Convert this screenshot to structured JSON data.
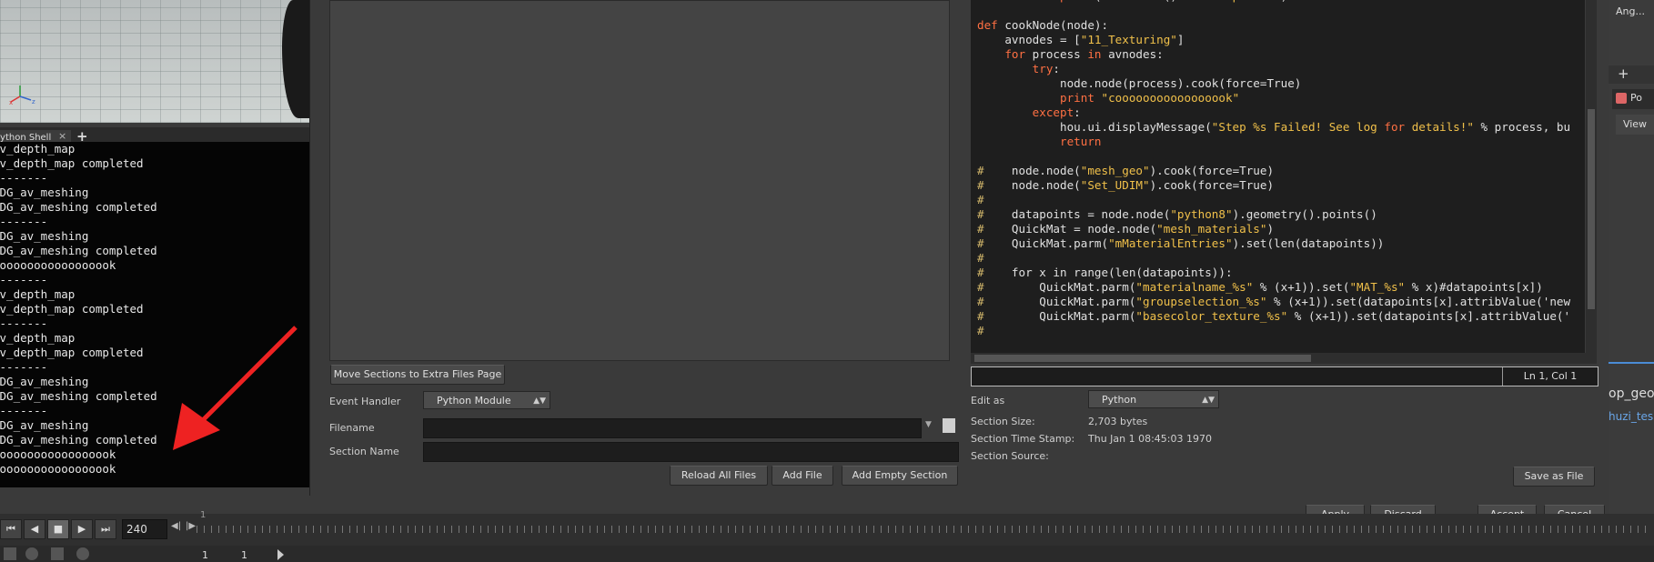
{
  "shell": {
    "tab_label": "Python Shell",
    "lines": [
      "av_depth_map",
      "av_depth_map completed",
      "--------",
      "PDG_av_meshing",
      "PDG_av_meshing completed",
      "--------",
      "PDG_av_meshing",
      "PDG_av_meshing completed",
      "cooooooooooooooook",
      "--------",
      "av_depth_map",
      "av_depth_map completed",
      "--------",
      "av_depth_map",
      "av_depth_map completed",
      "--------",
      "PDG_av_meshing",
      "PDG_av_meshing completed",
      "--------",
      "PDG_av_meshing",
      "PDG_av_meshing completed",
      "cooooooooooooooook",
      "cooooooooooooooook"
    ]
  },
  "timeline": {
    "current_frame": "240",
    "start_frame": "1",
    "range_start": "1",
    "range_end": "1"
  },
  "editor": {
    "move_sections_button": "Move Sections to Extra Files Page",
    "event_handler_label": "Event Handler",
    "event_handler_value": "Python Module",
    "filename_label": "Filename",
    "section_name_label": "Section Name",
    "reload_all_files_button": "Reload All Files",
    "add_file_button": "Add File",
    "add_empty_section_button": "Add Empty Section",
    "cursor_position": "Ln 1, Col 1",
    "edit_as_label": "Edit as",
    "edit_as_value": "Python",
    "section_size_label": "Section Size:",
    "section_size_value": "2,703 bytes",
    "section_timestamp_label": "Section Time Stamp:",
    "section_timestamp_value": "Thu Jan  1 08:45:03 1970",
    "section_source_label": "Section Source:",
    "save_as_file_button": "Save as File"
  },
  "dialog_buttons": {
    "apply": "Apply",
    "discard": "Discard",
    "accept": "Accept",
    "cancel": "Cancel"
  },
  "right_panel": {
    "top_label": "Ang...",
    "item_label": "Po",
    "view_button": "View",
    "node_label": "op_geo",
    "node_sub": "huzi_tes"
  },
  "code_lines": [
    {
      "t": "            print(node.name() + \" completed\")"
    },
    {
      "t": ""
    },
    {
      "t": "def cookNode(node):"
    },
    {
      "t": "    avnodes = [\"11_Texturing\"]"
    },
    {
      "t": "    for process in avnodes:"
    },
    {
      "t": "        try:"
    },
    {
      "t": "            node.node(process).cook(force=True)"
    },
    {
      "t": "            print \"cooooooooooooooook\""
    },
    {
      "t": "        except:"
    },
    {
      "t": "            hou.ui.displayMessage(\"Step %s Failed! See log for details!\" % process, bu"
    },
    {
      "t": "            return"
    },
    {
      "t": ""
    },
    {
      "t": "#    node.node(\"mesh_geo\").cook(force=True)"
    },
    {
      "t": "#    node.node(\"Set_UDIM\").cook(force=True)"
    },
    {
      "t": "#"
    },
    {
      "t": "#    datapoints = node.node(\"python8\").geometry().points()"
    },
    {
      "t": "#    QuickMat = node.node(\"mesh_materials\")"
    },
    {
      "t": "#    QuickMat.parm(\"mMaterialEntries\").set(len(datapoints))"
    },
    {
      "t": "#"
    },
    {
      "t": "#    for x in range(len(datapoints)):"
    },
    {
      "t": "#        QuickMat.parm(\"materialname_%s\" % (x+1)).set(\"MAT_%s\" % x)#datapoints[x])"
    },
    {
      "t": "#        QuickMat.parm(\"groupselection_%s\" % (x+1)).set(datapoints[x].attribValue('new"
    },
    {
      "t": "#        QuickMat.parm(\"basecolor_texture_%s\" % (x+1)).set(datapoints[x].attribValue('"
    },
    {
      "t": "#"
    }
  ]
}
